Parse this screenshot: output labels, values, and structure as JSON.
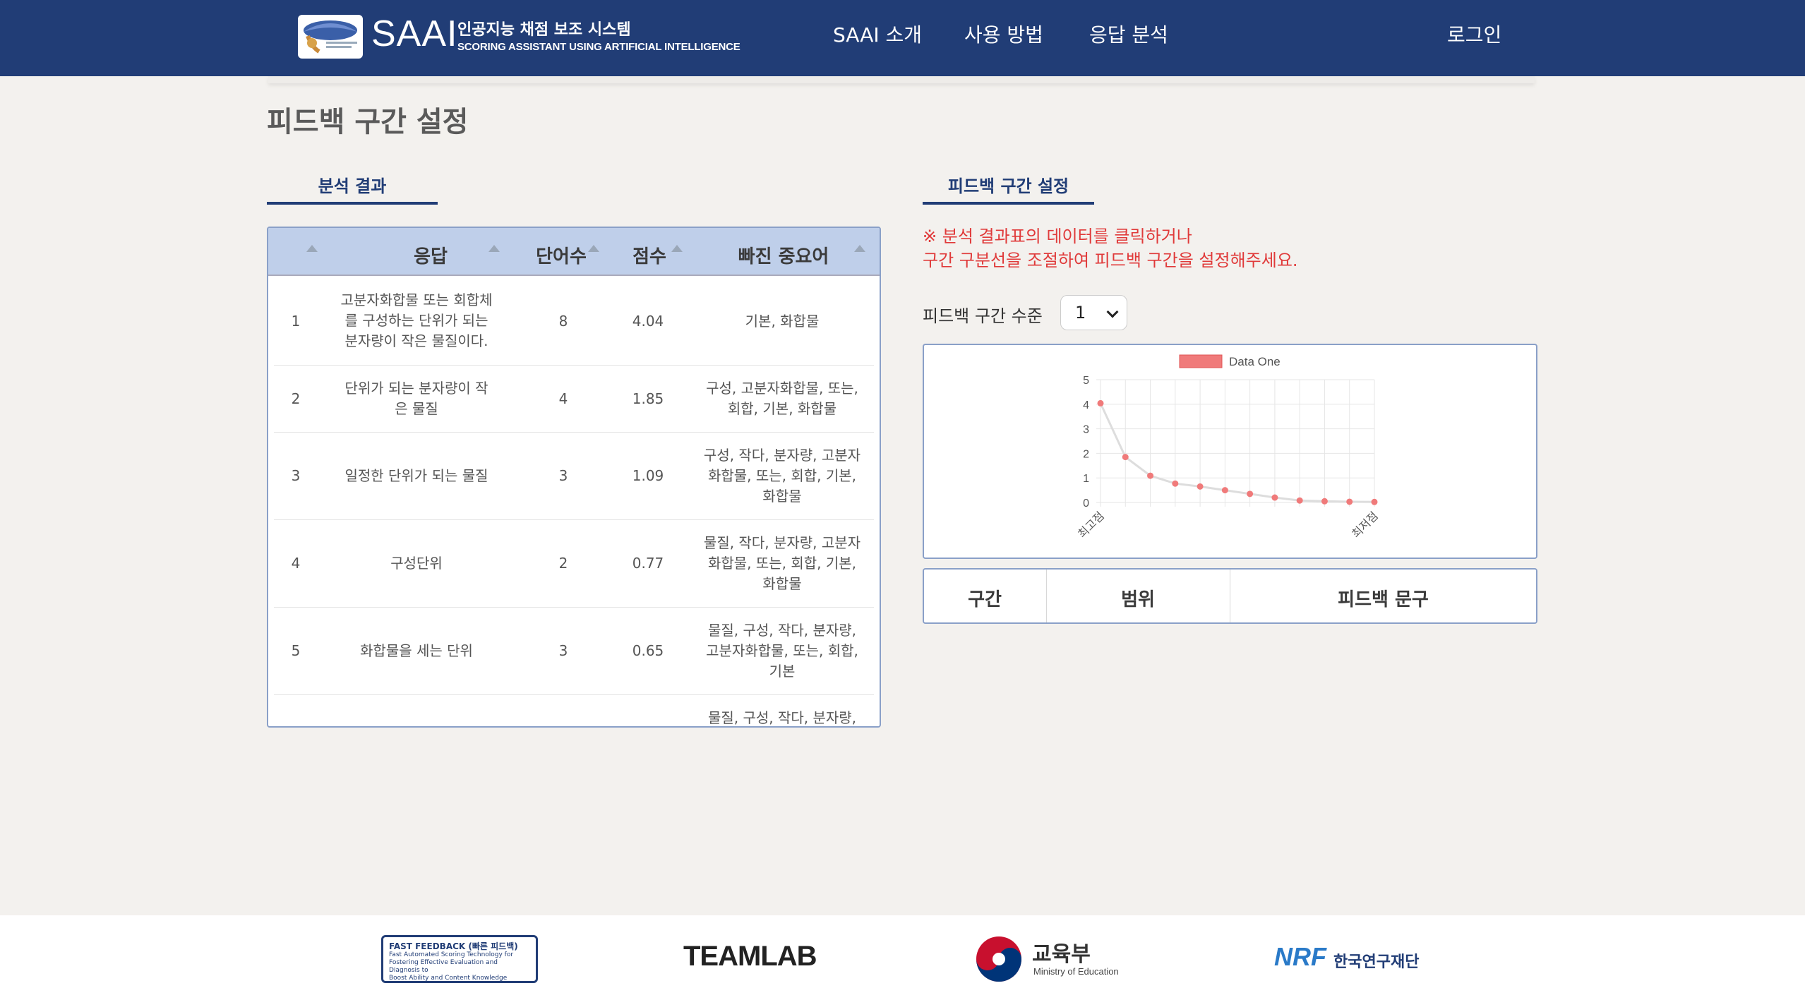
{
  "header": {
    "logo_text": "SAAI",
    "logo_sub_kr": "인공지능 채점 보조 시스템",
    "logo_sub_en": "SCORING ASSISTANT USING ARTIFICIAL INTELLIGENCE",
    "nav": [
      "SAAI 소개",
      "사용 방법",
      "응답 분석"
    ],
    "login": "로그인"
  },
  "page_title": "피드백 구간 설정",
  "left_tab": "분석 결과",
  "right_tab": "피드백 구간 설정",
  "table": {
    "headers": [
      "응답",
      "단어수",
      "점수",
      "빠진 중요어"
    ],
    "rows": [
      {
        "no": "1",
        "lines": [
          "고분자화합물 또는 회합체",
          "를 구성하는 단위가 되는",
          "분자량이 작은 물질이다."
        ],
        "words": "8",
        "score": "4.04",
        "missing": [
          "기본, 화합물"
        ]
      },
      {
        "no": "2",
        "lines": [
          "단위가 되는 분자량이 작",
          "은 물질"
        ],
        "words": "4",
        "score": "1.85",
        "missing": [
          "구성, 고분자화합물, 또는,",
          "회합, 기본, 화합물"
        ]
      },
      {
        "no": "3",
        "lines": [
          "일정한 단위가 되는 물질"
        ],
        "words": "3",
        "score": "1.09",
        "missing": [
          "구성, 작다, 분자량, 고분자",
          "화합물, 또는, 회합, 기본,",
          "화합물"
        ]
      },
      {
        "no": "4",
        "lines": [
          "구성단위"
        ],
        "words": "2",
        "score": "0.77",
        "missing": [
          "물질, 작다, 분자량, 고분자",
          "화합물, 또는, 회합, 기본,",
          "화합물"
        ]
      },
      {
        "no": "5",
        "lines": [
          "화합물을 세는 단위"
        ],
        "words": "3",
        "score": "0.65",
        "missing": [
          "물질, 구성, 작다, 분자량,",
          "고분자화합물, 또는, 회합,",
          "기본"
        ]
      },
      {
        "no": "",
        "lines": [
          ""
        ],
        "words": "",
        "score": "",
        "missing": [
          "물질, 구성, 작다, 분자량,"
        ]
      }
    ]
  },
  "notice": [
    "※ 분석 결과표의 데이터를 클릭하거나",
    "구간 구분선을 조절하여 피드백 구간을 설정해주세요."
  ],
  "level": {
    "label": "피드백 구간 수준",
    "value": "1"
  },
  "feedback_table": {
    "headers": [
      "구간",
      "범위",
      "피드백 문구"
    ]
  },
  "chart_data": {
    "type": "line",
    "series": [
      {
        "name": "Data One",
        "values": [
          4.04,
          1.85,
          1.09,
          0.77,
          0.65,
          0.5,
          0.35,
          0.2,
          0.08,
          0.05,
          0.03,
          0.02
        ]
      }
    ],
    "x_labels": [
      "최고점",
      "최저점"
    ],
    "ylim": [
      0,
      5
    ],
    "yticks": [
      0,
      1,
      2,
      3,
      4,
      5
    ],
    "grid": true,
    "legend": "top",
    "colors": {
      "series": "#f07a7a",
      "line": "#dddddd"
    }
  },
  "footer": {
    "fast_feedback_title": "FAST FEEDBACK (빠른 피드백)",
    "fast_feedback_sub": [
      "Fast Automated Scoring Technology for",
      "Fostering Effective Evaluation and Diagnosis to",
      "Boost Ability and Content Knowledge"
    ],
    "teamlab": "TEAMLAB",
    "moe_kr": "교육부",
    "moe_en": "Ministry of Education",
    "nrf": "NRF",
    "nrf_kr": "한국연구재단"
  }
}
